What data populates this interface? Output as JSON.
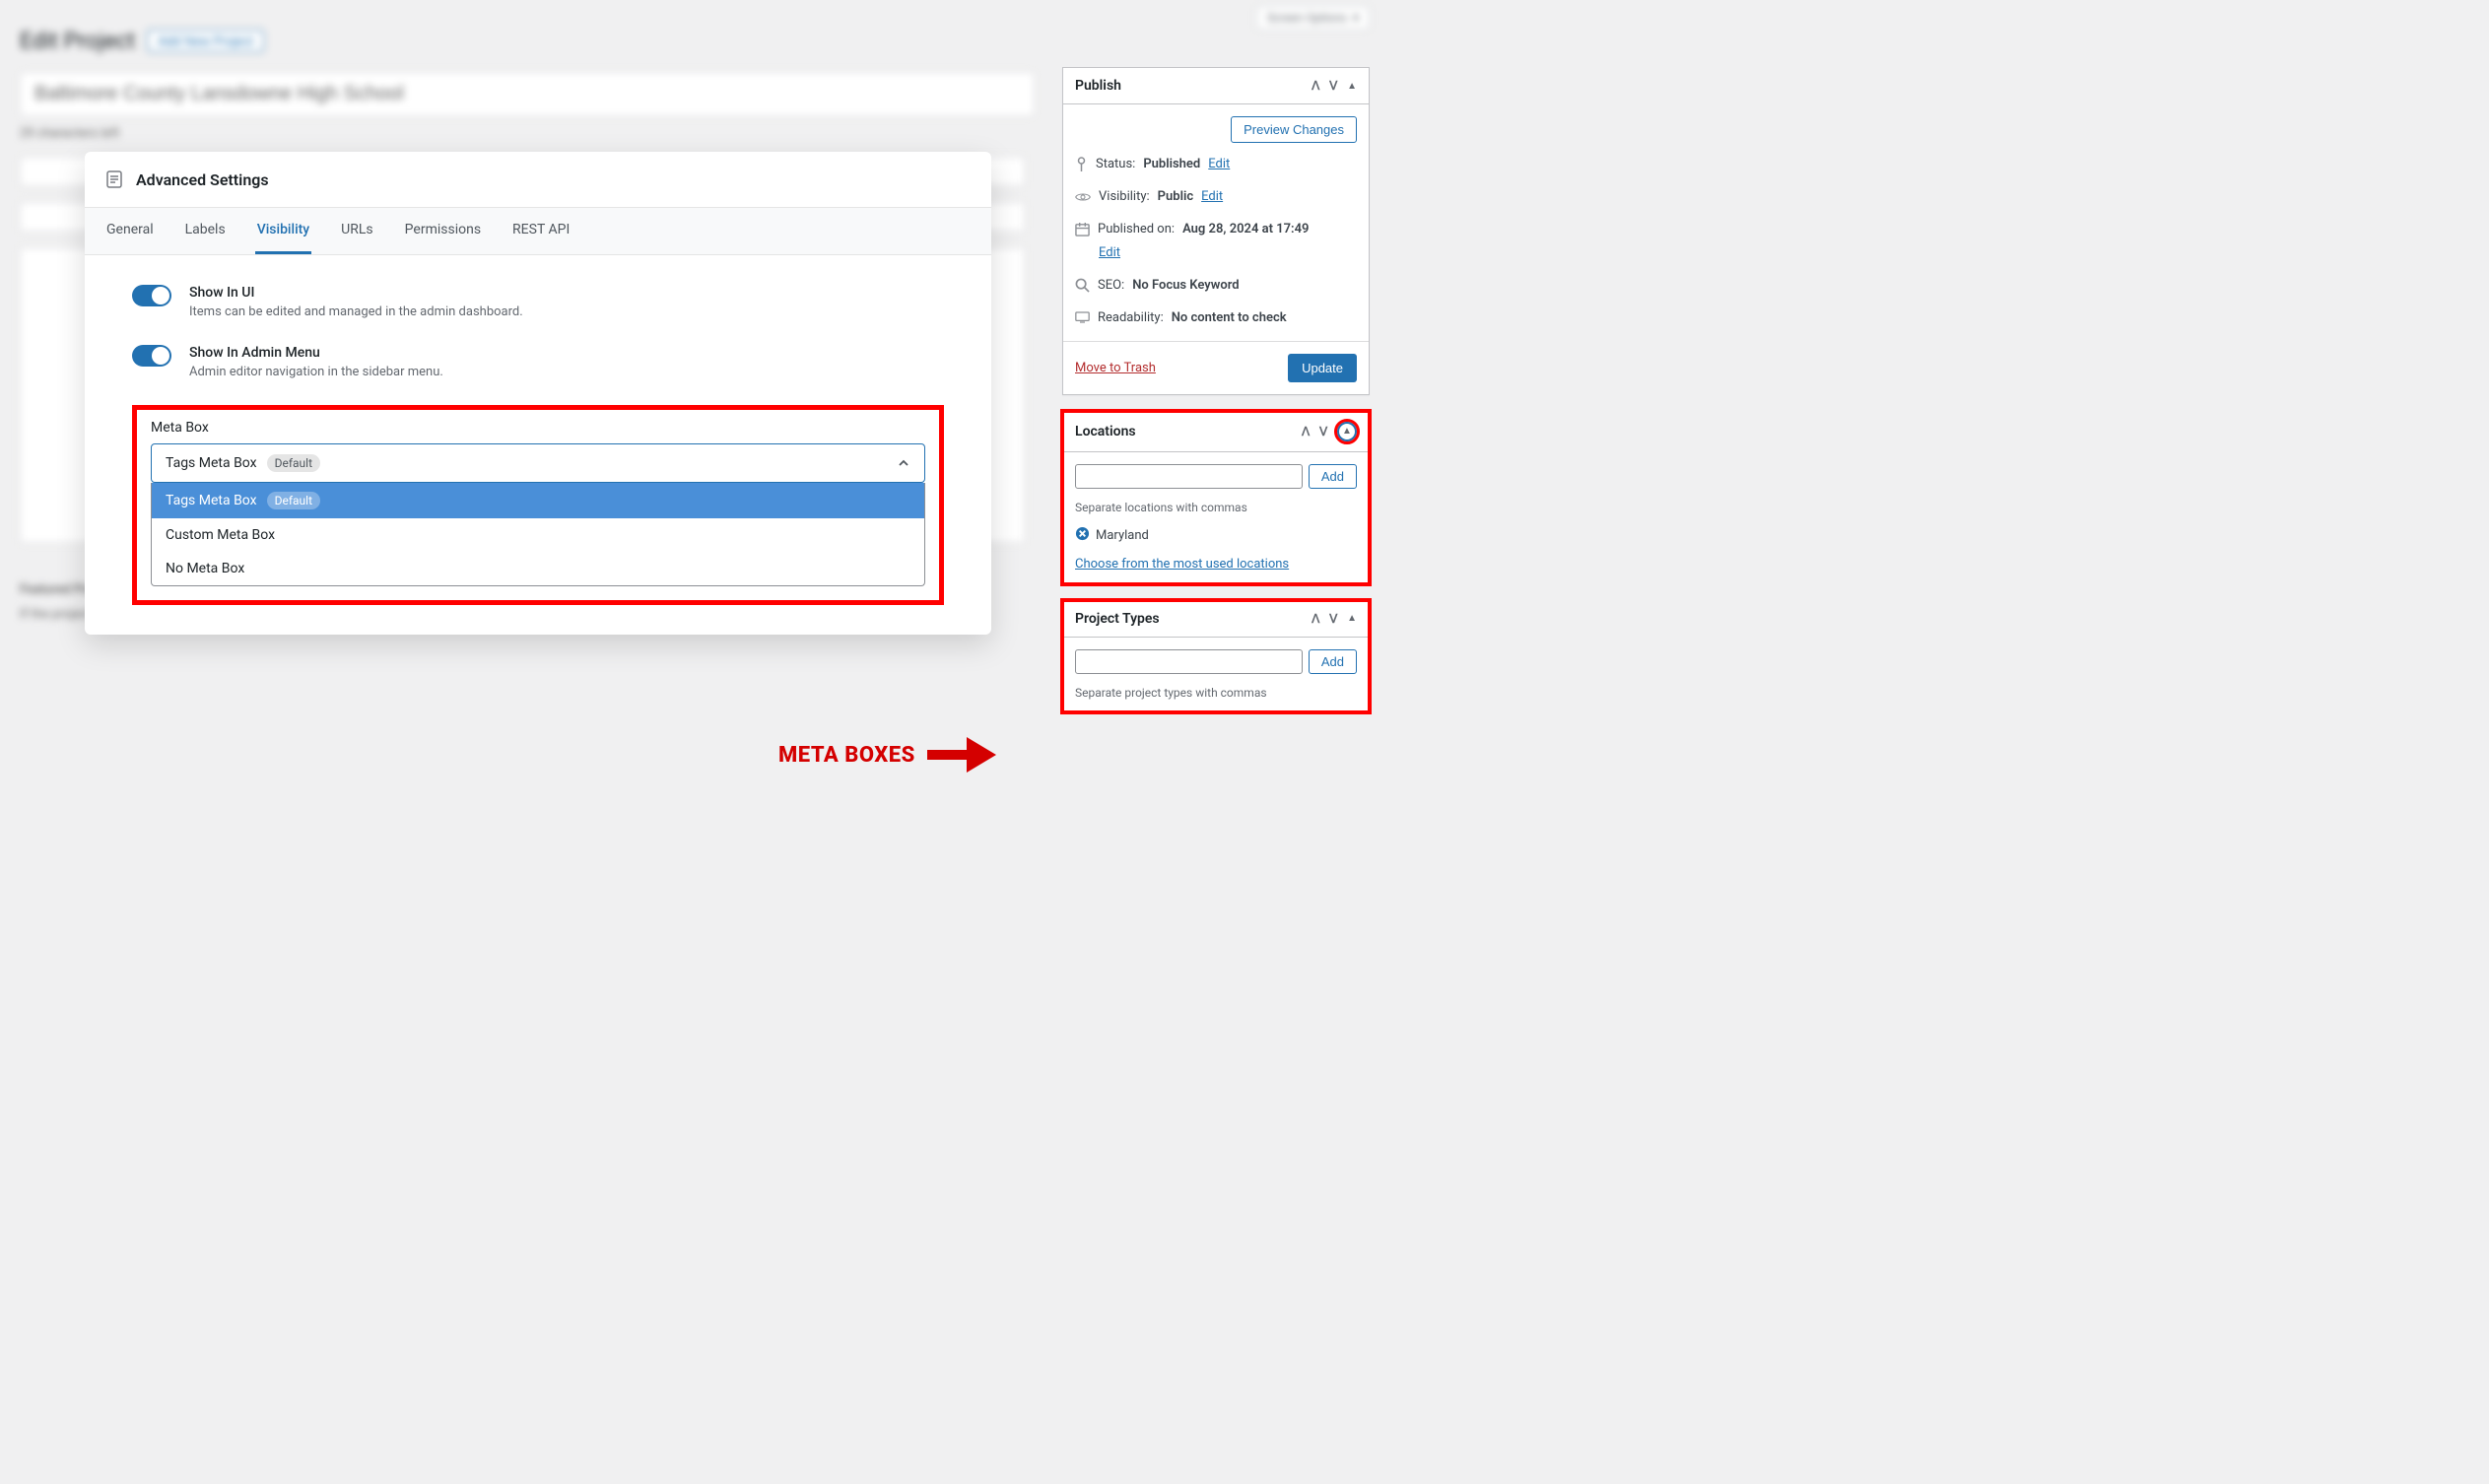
{
  "screen_options": "Screen Options",
  "page_title": "Edit Project",
  "add_new": "Add New Project",
  "title_input_value": "Baltimore County Lansdowne High School",
  "char_hint": "29 characters left",
  "modal": {
    "title": "Advanced Settings",
    "tabs": {
      "general": "General",
      "labels": "Labels",
      "visibility": "Visibility",
      "urls": "URLs",
      "permissions": "Permissions",
      "rest_api": "REST API"
    },
    "toggles": {
      "show_ui": {
        "title": "Show In UI",
        "desc": "Items can be edited and managed in the admin dashboard."
      },
      "show_admin_menu": {
        "title": "Show In Admin Menu",
        "desc": "Admin editor navigation in the sidebar menu."
      }
    },
    "metabox": {
      "label": "Meta Box",
      "selected": "Tags Meta Box",
      "default_badge": "Default",
      "options": {
        "tags": "Tags Meta Box",
        "custom": "Custom Meta Box",
        "none": "No Meta Box"
      }
    }
  },
  "publish": {
    "title": "Publish",
    "preview_changes": "Preview Changes",
    "status_label": "Status:",
    "status_value": "Published",
    "visibility_label": "Visibility:",
    "visibility_value": "Public",
    "published_on_label": "Published on:",
    "published_on_value": "Aug 28, 2024 at 17:49",
    "seo_label": "SEO:",
    "seo_value": "No Focus Keyword",
    "readability_label": "Readability:",
    "readability_value": "No content to check",
    "edit": "Edit",
    "move_to_trash": "Move to Trash",
    "update": "Update"
  },
  "locations": {
    "title": "Locations",
    "add": "Add",
    "hint": "Separate locations with commas",
    "tag": "Maryland",
    "choose_link": "Choose from the most used locations"
  },
  "project_types": {
    "title": "Project Types",
    "add": "Add",
    "hint": "Separate project types with commas"
  },
  "annotation": {
    "meta_boxes": "META BOXES"
  },
  "blur": {
    "featured_title": "Featured Project Visibility",
    "featured_desc": "If the project is featured then additional project details are displayed"
  }
}
